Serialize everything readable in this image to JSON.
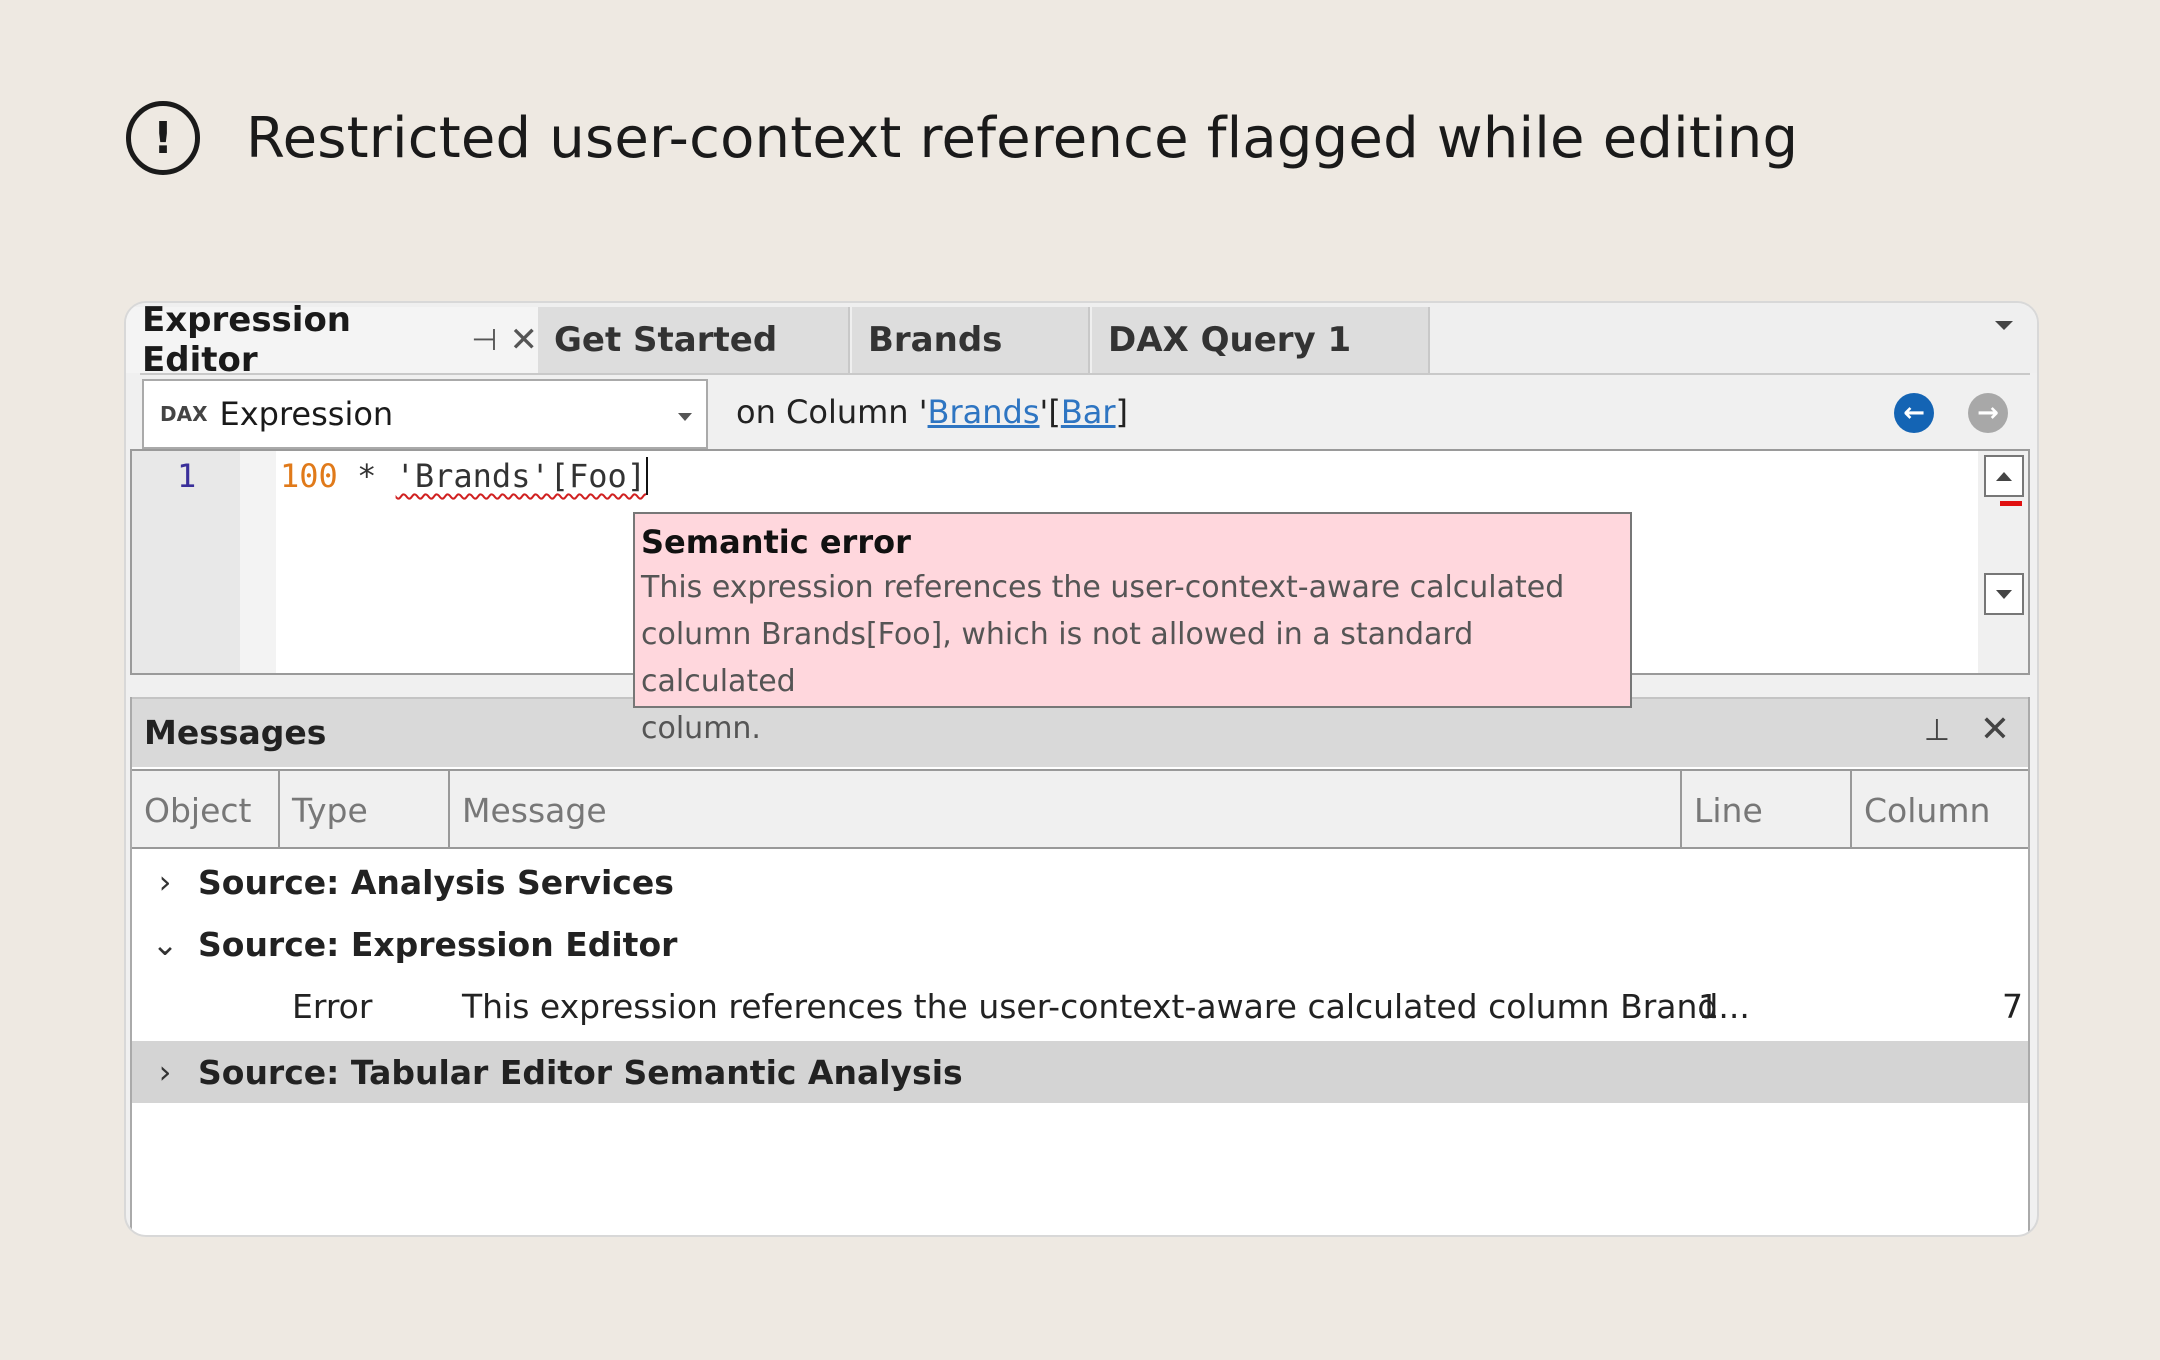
{
  "header": {
    "title": "Restricted user-context reference flagged while editing"
  },
  "tabs": [
    {
      "label": "Expression Editor",
      "active": true
    },
    {
      "label": "Get Started"
    },
    {
      "label": "Brands"
    },
    {
      "label": "DAX Query 1"
    }
  ],
  "expression_bar": {
    "dropdown_badge": "DAX",
    "dropdown_value": "Expression",
    "on_column_prefix": "on Column '",
    "table_link": "Brands",
    "mid": "'[",
    "column_link": "Bar",
    "suffix": "]"
  },
  "editor": {
    "line_number": "1",
    "code_number": "100",
    "code_operator": " * ",
    "code_reference": "'Brands'[Foo]"
  },
  "tooltip": {
    "title": "Semantic error",
    "body_line1": "This expression references the user-context-aware calculated",
    "body_line2": "column Brands[Foo], which is not allowed in a standard calculated",
    "body_line3": "column."
  },
  "messages": {
    "title": "Messages",
    "columns": [
      "Object",
      "Type",
      "Message",
      "Line",
      "Column"
    ],
    "groups": [
      {
        "label": "Source: Analysis Services",
        "expanded": false
      },
      {
        "label": "Source: Expression Editor",
        "expanded": true
      },
      {
        "label": "Source: Tabular Editor Semantic Analysis",
        "expanded": false,
        "selected": true
      }
    ],
    "error_row": {
      "type": "Error",
      "message": "This expression references the user-context-aware calculated column Brand...",
      "line": "1",
      "column": "7"
    }
  },
  "colors": {
    "background": "#eee9e2",
    "error_tooltip": "#ffd7dd",
    "link": "#2e75c2",
    "nav_back": "#1464b4",
    "number_literal": "#e07a1a"
  }
}
